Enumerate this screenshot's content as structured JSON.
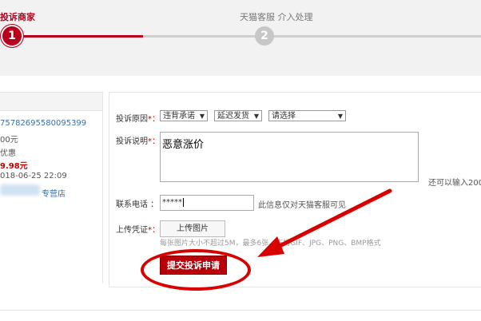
{
  "steps": {
    "step1_title": "投诉商家",
    "step1_num": "1",
    "step2_title": "天猫客服 介入处理",
    "step2_num": "2",
    "active_color": "#b8001c"
  },
  "order": {
    "order_no": "75782695580095399",
    "amount": "00元",
    "discount": "优惠",
    "paid": "9.98元",
    "time": "018-06-25 22:09",
    "shop": "专营店"
  },
  "form": {
    "reason_label": "投诉原因",
    "reason_options": [
      "违背承诺",
      "延迟发货",
      "请选择"
    ],
    "desc_label": "投诉说明",
    "desc_value": "恶意涨价",
    "desc_count_hint": "还可以输入200",
    "phone_label": "联系电话 ：",
    "phone_value": "*****",
    "phone_hint": "此信息仅对天猫客服可见",
    "proof_label": "上传凭证",
    "upload_label": "上传图片",
    "upload_hint": "每张图片大小不超过5M，最多6张，支持GIF、JPG、PNG、BMP格式",
    "submit_label": "提交投诉申请",
    "required_mark": "*："
  },
  "annotation_color": "#d90000"
}
